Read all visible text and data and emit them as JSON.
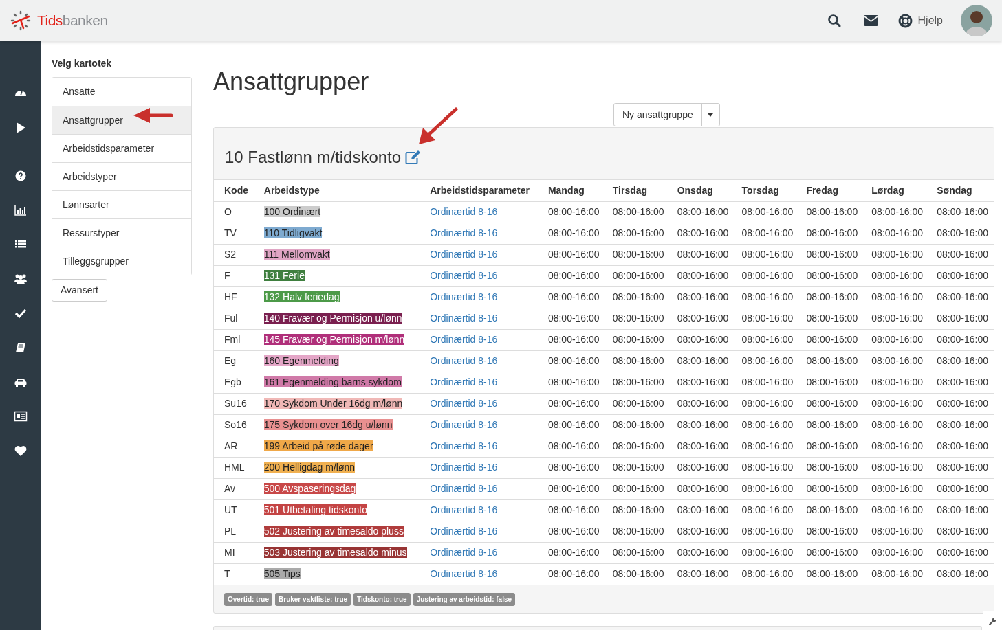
{
  "brand": {
    "name_part1": "Tids",
    "name_part2": "banken"
  },
  "header": {
    "help_label": "Hjelp"
  },
  "kartotek": {
    "title": "Velg kartotek",
    "items": [
      {
        "label": "Ansatte",
        "selected": false
      },
      {
        "label": "Ansattgrupper",
        "selected": true
      },
      {
        "label": "Arbeidstidsparameter",
        "selected": false
      },
      {
        "label": "Arbeidstyper",
        "selected": false
      },
      {
        "label": "Lønnsarter",
        "selected": false
      },
      {
        "label": "Ressurstyper",
        "selected": false
      },
      {
        "label": "Tilleggsgrupper",
        "selected": false
      }
    ],
    "advanced_button": "Avansert"
  },
  "page_title": "Ansattgrupper",
  "new_button": "Ny ansattgruppe",
  "group": {
    "title": "10 Fastlønn m/tidskonto",
    "columns": [
      "Kode",
      "Arbeidstype",
      "Arbeidstidsparameter",
      "Mandag",
      "Tirsdag",
      "Onsdag",
      "Torsdag",
      "Fredag",
      "Lørdag",
      "Søndag"
    ],
    "rows": [
      {
        "code": "O",
        "type": "100 Ordinært",
        "color": "#cccccc",
        "param": "Ordinærtid 8-16",
        "times": [
          "08:00-16:00",
          "08:00-16:00",
          "08:00-16:00",
          "08:00-16:00",
          "08:00-16:00",
          "08:00-16:00",
          "08:00-16:00"
        ]
      },
      {
        "code": "TV",
        "type": "110 Tidligvakt",
        "color": "#7eaad0",
        "param": "Ordinærtid 8-16",
        "times": [
          "08:00-16:00",
          "08:00-16:00",
          "08:00-16:00",
          "08:00-16:00",
          "08:00-16:00",
          "08:00-16:00",
          "08:00-16:00"
        ]
      },
      {
        "code": "S2",
        "type": "111 Mellomvakt",
        "color": "#e0a5c4",
        "param": "Ordinærtid 8-16",
        "times": [
          "08:00-16:00",
          "08:00-16:00",
          "08:00-16:00",
          "08:00-16:00",
          "08:00-16:00",
          "08:00-16:00",
          "08:00-16:00"
        ]
      },
      {
        "code": "F",
        "type": "131 Ferie",
        "color": "#3f7f3f",
        "param": "Ordinærtid 8-16",
        "times": [
          "08:00-16:00",
          "08:00-16:00",
          "08:00-16:00",
          "08:00-16:00",
          "08:00-16:00",
          "08:00-16:00",
          "08:00-16:00"
        ]
      },
      {
        "code": "HF",
        "type": "132 Halv feriedag",
        "color": "#4c9a48",
        "param": "Ordinærtid 8-16",
        "times": [
          "08:00-16:00",
          "08:00-16:00",
          "08:00-16:00",
          "08:00-16:00",
          "08:00-16:00",
          "08:00-16:00",
          "08:00-16:00"
        ]
      },
      {
        "code": "Ful",
        "type": "140 Fravær og Permisjon u/lønn",
        "color": "#7a1f4f",
        "param": "Ordinærtid 8-16",
        "times": [
          "08:00-16:00",
          "08:00-16:00",
          "08:00-16:00",
          "08:00-16:00",
          "08:00-16:00",
          "08:00-16:00",
          "08:00-16:00"
        ]
      },
      {
        "code": "Fml",
        "type": "145 Fravær og Permisjon m/lønn",
        "color": "#b02f7a",
        "param": "Ordinærtid 8-16",
        "times": [
          "08:00-16:00",
          "08:00-16:00",
          "08:00-16:00",
          "08:00-16:00",
          "08:00-16:00",
          "08:00-16:00",
          "08:00-16:00"
        ]
      },
      {
        "code": "Eg",
        "type": "160 Egenmelding",
        "color": "#e4a6c7",
        "param": "Ordinærtid 8-16",
        "times": [
          "08:00-16:00",
          "08:00-16:00",
          "08:00-16:00",
          "08:00-16:00",
          "08:00-16:00",
          "08:00-16:00",
          "08:00-16:00"
        ]
      },
      {
        "code": "Egb",
        "type": "161 Egenmelding barns sykdom",
        "color": "#d07aa8",
        "param": "Ordinærtid 8-16",
        "times": [
          "08:00-16:00",
          "08:00-16:00",
          "08:00-16:00",
          "08:00-16:00",
          "08:00-16:00",
          "08:00-16:00",
          "08:00-16:00"
        ]
      },
      {
        "code": "Su16",
        "type": "170 Sykdom Under 16dg m/lønn",
        "color": "#f0b8b6",
        "param": "Ordinærtid 8-16",
        "times": [
          "08:00-16:00",
          "08:00-16:00",
          "08:00-16:00",
          "08:00-16:00",
          "08:00-16:00",
          "08:00-16:00",
          "08:00-16:00"
        ]
      },
      {
        "code": "So16",
        "type": "175 Sykdom over 16dg u/lønn",
        "color": "#e89090",
        "param": "Ordinærtid 8-16",
        "times": [
          "08:00-16:00",
          "08:00-16:00",
          "08:00-16:00",
          "08:00-16:00",
          "08:00-16:00",
          "08:00-16:00",
          "08:00-16:00"
        ]
      },
      {
        "code": "AR",
        "type": "199 Arbeid på røde dager",
        "color": "#f0a848",
        "param": "Ordinærtid 8-16",
        "times": [
          "08:00-16:00",
          "08:00-16:00",
          "08:00-16:00",
          "08:00-16:00",
          "08:00-16:00",
          "08:00-16:00",
          "08:00-16:00"
        ]
      },
      {
        "code": "HML",
        "type": "200 Helligdag m/lønn",
        "color": "#f0b050",
        "param": "Ordinærtid 8-16",
        "times": [
          "08:00-16:00",
          "08:00-16:00",
          "08:00-16:00",
          "08:00-16:00",
          "08:00-16:00",
          "08:00-16:00",
          "08:00-16:00"
        ]
      },
      {
        "code": "Av",
        "type": "500 Avspaseringsdag",
        "color": "#c84848",
        "param": "Ordinærtid 8-16",
        "times": [
          "08:00-16:00",
          "08:00-16:00",
          "08:00-16:00",
          "08:00-16:00",
          "08:00-16:00",
          "08:00-16:00",
          "08:00-16:00"
        ]
      },
      {
        "code": "UT",
        "type": "501 Utbetaling tidskonto",
        "color": "#c44444",
        "param": "Ordinærtid 8-16",
        "times": [
          "08:00-16:00",
          "08:00-16:00",
          "08:00-16:00",
          "08:00-16:00",
          "08:00-16:00",
          "08:00-16:00",
          "08:00-16:00"
        ]
      },
      {
        "code": "PL",
        "type": "502 Justering av timesaldo pluss",
        "color": "#b03c3c",
        "param": "Ordinærtid 8-16",
        "times": [
          "08:00-16:00",
          "08:00-16:00",
          "08:00-16:00",
          "08:00-16:00",
          "08:00-16:00",
          "08:00-16:00",
          "08:00-16:00"
        ]
      },
      {
        "code": "MI",
        "type": "503 Justering av timesaldo minus",
        "color": "#983434",
        "param": "Ordinærtid 8-16",
        "times": [
          "08:00-16:00",
          "08:00-16:00",
          "08:00-16:00",
          "08:00-16:00",
          "08:00-16:00",
          "08:00-16:00",
          "08:00-16:00"
        ]
      },
      {
        "code": "T",
        "type": "505 Tips",
        "color": "#aaaaaa",
        "param": "Ordinærtid 8-16",
        "times": [
          "08:00-16:00",
          "08:00-16:00",
          "08:00-16:00",
          "08:00-16:00",
          "08:00-16:00",
          "08:00-16:00",
          "08:00-16:00"
        ]
      }
    ],
    "badges": [
      "Overtid: true",
      "Bruker vaktliste: true",
      "Tidskonto: true",
      "Justering av arbeidstid: false"
    ]
  }
}
